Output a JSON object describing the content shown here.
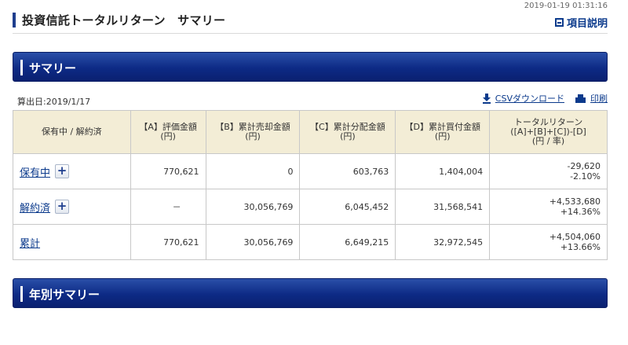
{
  "timestamp": "2019-01-19 01:31:16",
  "title": "投資信託トータルリターン　サマリー",
  "help_link": "項目説明",
  "summary_section": "サマリー",
  "calc_date": "算出日:2019/1/17",
  "tools": {
    "csv": "CSVダウンロード",
    "print": "印刷"
  },
  "table": {
    "headers": {
      "status": "保有中 / 解約済",
      "a_line1": "【A】評価金額",
      "a_line2": "(円)",
      "b_line1": "【B】累計売却金額",
      "b_line2": "(円)",
      "c_line1": "【C】累計分配金額",
      "c_line2": "(円)",
      "d_line1": "【D】累計買付金額",
      "d_line2": "(円)",
      "r_line1": "トータルリターン",
      "r_line2": "([A]+[B]+[C])-[D]",
      "r_line3": "(円 / 率)"
    },
    "rows": [
      {
        "label": "保有中",
        "plus": "+",
        "a": "770,621",
        "b": "0",
        "c": "603,763",
        "d": "1,404,004",
        "ret_amount": "-29,620",
        "ret_rate": "-2.10%",
        "sign": "neg"
      },
      {
        "label": "解約済",
        "plus": "+",
        "a": "－",
        "b": "30,056,769",
        "c": "6,045,452",
        "d": "31,568,541",
        "ret_amount": "+4,533,680",
        "ret_rate": "+14.36%",
        "sign": "pos"
      },
      {
        "label": "累計",
        "a": "770,621",
        "b": "30,056,769",
        "c": "6,649,215",
        "d": "32,972,545",
        "ret_amount": "+4,504,060",
        "ret_rate": "+13.66%",
        "sign": "pos"
      }
    ]
  },
  "yearly_section": "年別サマリー",
  "colors": {
    "header_blue": "#0d2a85",
    "table_header_bg": "#f3edd6",
    "negative": "#2255cc",
    "positive": "#e21a1a"
  }
}
